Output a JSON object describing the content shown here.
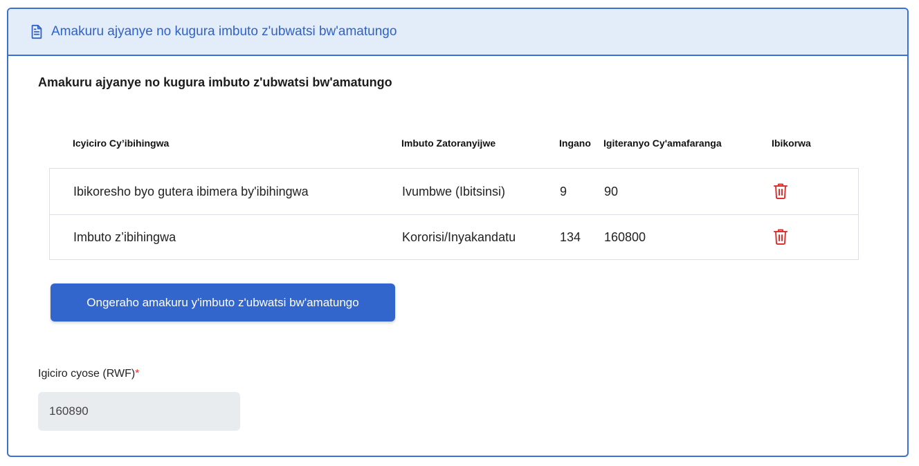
{
  "header": {
    "title": "Amakuru ajyanye no kugura imbuto z'ubwatsi bw'amatungo"
  },
  "section": {
    "title": "Amakuru ajyanye no kugura imbuto z'ubwatsi bw'amatungo"
  },
  "table": {
    "columns": [
      "Icyiciro Cy’ibihingwa",
      "Imbuto Zatoranyijwe",
      "Ingano",
      "Igiteranyo Cy'amafaranga",
      "Ibikorwa"
    ],
    "rows": [
      {
        "category": "Ibikoresho byo gutera ibimera by'ibihingwa",
        "seed": "Ivumbwe (Ibitsinsi)",
        "quantity": "9",
        "amount": "90",
        "action_icon": "trash-icon"
      },
      {
        "category": "Imbuto z’ibihingwa",
        "seed": "Kororisi/Inyakandatu",
        "quantity": "134",
        "amount": "160800",
        "action_icon": "trash-icon"
      }
    ]
  },
  "add_button": {
    "label": "Ongeraho amakuru y'imbuto z'ubwatsi bw'amatungo"
  },
  "total": {
    "label": "Igiciro cyose (RWF)",
    "required_mark": "*",
    "value": "160890"
  },
  "colors": {
    "accent": "#3366cc",
    "header_bg": "#e3edfa",
    "danger": "#e03131",
    "input_bg": "#e9ecef"
  }
}
